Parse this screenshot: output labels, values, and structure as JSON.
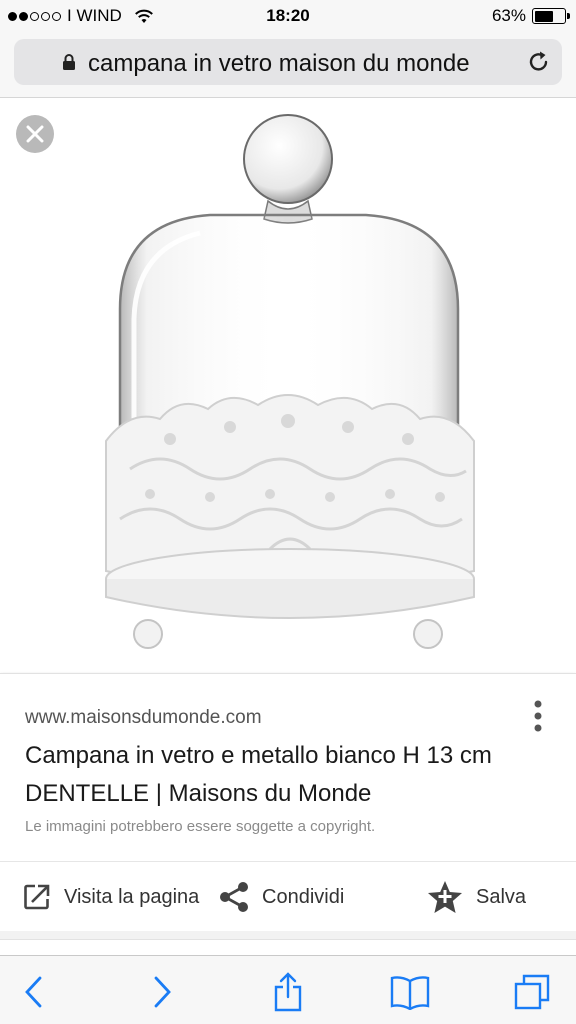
{
  "status_bar": {
    "carrier": "I WIND",
    "signal_bars_filled": 2,
    "signal_bars_total": 5,
    "time": "18:20",
    "battery_percent": "63%",
    "battery_level": 0.63
  },
  "url_bar": {
    "text": "campana in vetro maison du monde",
    "icons": [
      "lock-icon",
      "reload-icon"
    ]
  },
  "image_viewer": {
    "close_icon": "close-icon"
  },
  "result": {
    "site": "www.maisonsdumonde.com",
    "title": "Campana in vetro e metallo bianco H 13 cm DENTELLE | Maisons du Monde",
    "copyright_note": "Le immagini potrebbero essere soggette a copyright.",
    "actions": {
      "visit_label": "Visita la pagina",
      "share_label": "Condividi",
      "save_label": "Salva"
    }
  },
  "toolbar": {
    "icons": [
      "back-icon",
      "forward-icon",
      "share-icon",
      "bookmarks-icon",
      "tabs-icon"
    ]
  },
  "colors": {
    "accent": "#1a7cf5",
    "card_text": "#1a1a1a",
    "muted_text": "#8a8a8a"
  }
}
